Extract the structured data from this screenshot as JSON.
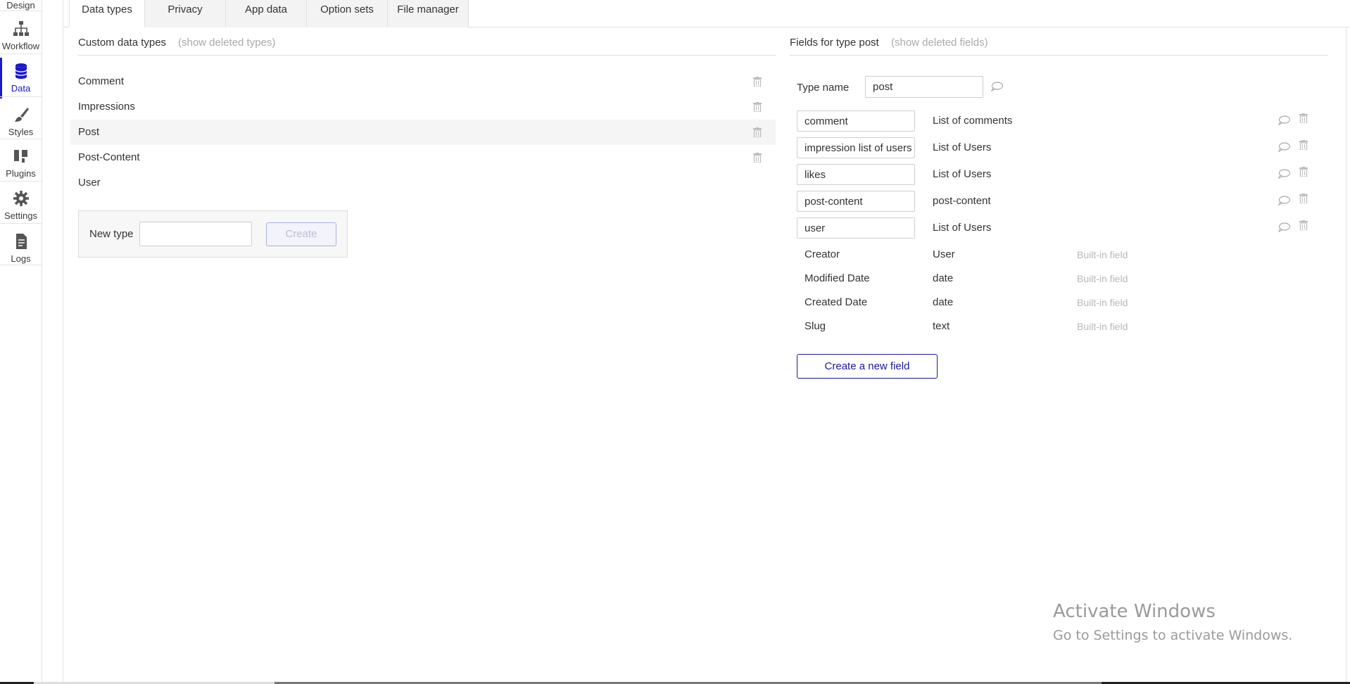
{
  "nav": {
    "design_label": "Design",
    "items": [
      {
        "label": "Workflow",
        "icon": "workflow-icon"
      },
      {
        "label": "Data",
        "icon": "database-icon"
      },
      {
        "label": "Styles",
        "icon": "brush-icon"
      },
      {
        "label": "Plugins",
        "icon": "plug-icon"
      },
      {
        "label": "Settings",
        "icon": "gear-icon"
      },
      {
        "label": "Logs",
        "icon": "document-icon"
      }
    ],
    "accent": "#1a1ac9"
  },
  "tabs": [
    "Data types",
    "Privacy",
    "App data",
    "Option sets",
    "File manager"
  ],
  "types_panel": {
    "title": "Custom data types",
    "show_deleted": "(show deleted types)",
    "types": [
      "Comment",
      "Impressions",
      "Post",
      "Post-Content",
      "User"
    ],
    "selected": "Post",
    "new_type_label": "New type",
    "new_type_value": "",
    "create_label": "Create"
  },
  "fields_panel": {
    "title": "Fields for type post",
    "show_deleted": "(show deleted fields)",
    "type_name_label": "Type name",
    "type_name_value": "post",
    "fields": [
      {
        "name": "comment",
        "type": "List of comments"
      },
      {
        "name": "impression list of users",
        "type": "List of Users"
      },
      {
        "name": "likes",
        "type": "List of Users"
      },
      {
        "name": "post-content",
        "type": "post-content"
      },
      {
        "name": "user",
        "type": "List of Users"
      }
    ],
    "builtin_fields": [
      {
        "name": "Creator",
        "type": "User",
        "tag": "Built-in field"
      },
      {
        "name": "Modified Date",
        "type": "date",
        "tag": "Built-in field"
      },
      {
        "name": "Created Date",
        "type": "date",
        "tag": "Built-in field"
      },
      {
        "name": "Slug",
        "type": "text",
        "tag": "Built-in field"
      }
    ],
    "create_field_label": "Create a new field"
  },
  "watermark": {
    "line1": "Activate Windows",
    "line2": "Go to Settings to activate Windows."
  }
}
